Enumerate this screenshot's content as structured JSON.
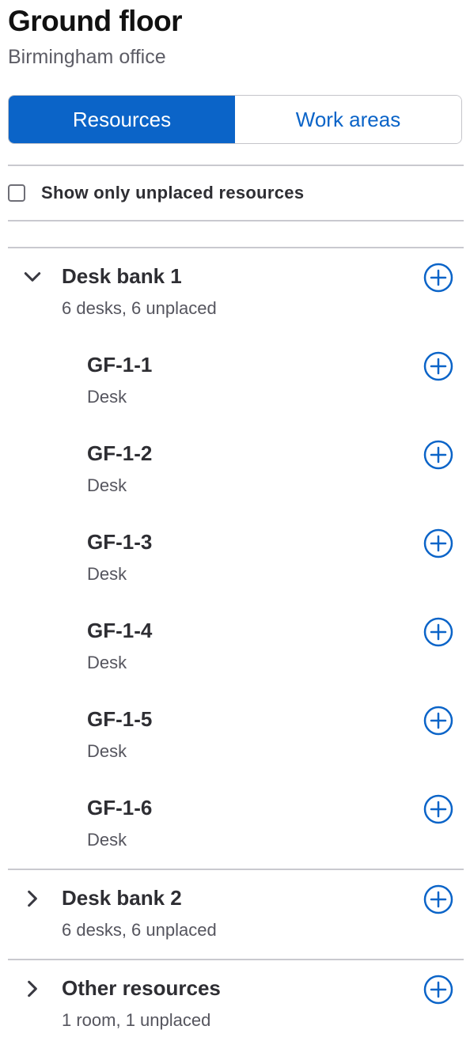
{
  "header": {
    "title": "Ground floor",
    "subtitle": "Birmingham office"
  },
  "tabs": [
    {
      "label": "Resources",
      "active": true
    },
    {
      "label": "Work areas",
      "active": false
    }
  ],
  "filter": {
    "label": "Show only unplaced resources",
    "checked": false
  },
  "groups": [
    {
      "title": "Desk bank 1",
      "summary": "6 desks, 6 unplaced",
      "expanded": true,
      "items": [
        {
          "name": "GF-1-1",
          "type": "Desk"
        },
        {
          "name": "GF-1-2",
          "type": "Desk"
        },
        {
          "name": "GF-1-3",
          "type": "Desk"
        },
        {
          "name": "GF-1-4",
          "type": "Desk"
        },
        {
          "name": "GF-1-5",
          "type": "Desk"
        },
        {
          "name": "GF-1-6",
          "type": "Desk"
        }
      ]
    },
    {
      "title": "Desk bank 2",
      "summary": "6 desks, 6 unplaced",
      "expanded": false
    },
    {
      "title": "Other resources",
      "summary": "1 room, 1 unplaced",
      "expanded": false
    }
  ],
  "icons": {
    "add": "add-circle-icon",
    "expanded": "chevron-down-icon",
    "collapsed": "chevron-right-icon"
  },
  "colors": {
    "accent": "#0b64c8",
    "divider": "#c9c9cf"
  }
}
